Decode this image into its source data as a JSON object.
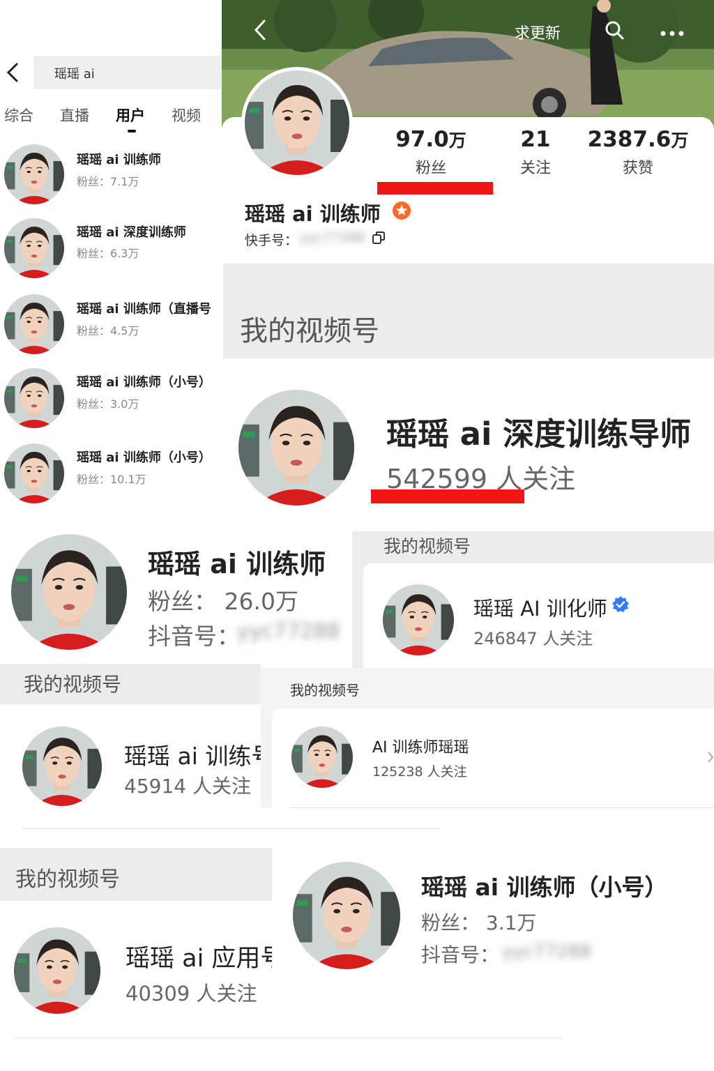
{
  "search_panel": {
    "query": "瑶瑶 ai",
    "tabs": [
      "综合",
      "直播",
      "用户",
      "视频"
    ],
    "active_tab": "用户",
    "results": [
      {
        "name": "瑶瑶 ai 训练师",
        "fans": "粉丝：7.1万"
      },
      {
        "name": "瑶瑶 ai 深度训练师",
        "fans": "粉丝：6.3万"
      },
      {
        "name": "瑶瑶 ai 训练师（直播号",
        "fans": "粉丝：4.5万"
      },
      {
        "name": "瑶瑶 ai 训练师（小号）",
        "fans": "粉丝：3.0万"
      },
      {
        "name": "瑶瑶 ai 训练师（小号）",
        "fans": "粉丝：10.1万"
      }
    ]
  },
  "kuaishou_profile": {
    "update_button": "求更新",
    "stats": [
      {
        "number": "97.0",
        "unit": "万",
        "label": "粉丝"
      },
      {
        "number": "21",
        "unit": "",
        "label": "关注"
      },
      {
        "number": "2387.6",
        "unit": "万",
        "label": "获赞"
      }
    ],
    "name": "瑶瑶 ai 训练师",
    "id_label": "快手号：",
    "id_value": "yyc77288"
  },
  "channel_large": {
    "section_title": "我的视频号",
    "name": "瑶瑶 ai 深度训练导师",
    "followers": "542599 人关注"
  },
  "douyin_profile_1": {
    "name": "瑶瑶 ai 训练师",
    "fans": "粉丝： 26.0万",
    "id_label": "抖音号：",
    "id_value": "yyc77288"
  },
  "channel_verified": {
    "section_title": "我的视频号",
    "name": "瑶瑶 AI 训化师",
    "followers": "246847 人关注"
  },
  "channel_trainer_no": {
    "section_title": "我的视频号",
    "name": "瑶瑶 ai 训练号",
    "followers": "45914 人关注"
  },
  "channel_ai_trainer": {
    "section_title": "我的视频号",
    "name": "AI 训练师瑶瑶",
    "followers": "125238 人关注"
  },
  "channel_app": {
    "section_title": "我的视频号",
    "name": "瑶瑶 ai 应用号",
    "followers": "40309 人关注"
  },
  "douyin_profile_2": {
    "name": "瑶瑶 ai 训练师（小号）",
    "fans": "粉丝： 3.1万",
    "id_label": "抖音号：",
    "id_value": "yyc77288"
  },
  "colors": {
    "highlight_red": "#f01414",
    "verified_blue": "#2f7cf6",
    "kuaishou_badge": "#ff6a2c"
  }
}
